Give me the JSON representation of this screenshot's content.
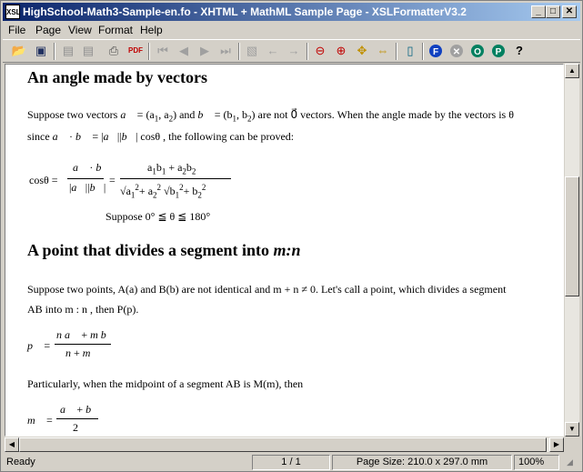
{
  "window": {
    "title": "HighSchool-Math3-Sample-en.fo - XHTML + MathML Sample Page - XSLFormatterV3.2",
    "icon_text": "XSL"
  },
  "menu": [
    "File",
    "Page",
    "View",
    "Format",
    "Help"
  ],
  "toolbar": {
    "icons": [
      "open-icon",
      "save-icon",
      "page-icon",
      "page-copy-icon",
      "print-icon",
      "pdf-icon",
      "first-page-icon",
      "prev-page-icon",
      "next-page-icon",
      "last-page-icon",
      "page-back-icon",
      "history-back-icon",
      "history-forward-icon",
      "zoom-out-icon",
      "zoom-in-icon",
      "fit-page-icon",
      "fit-width-icon",
      "single-page-icon",
      "f-icon",
      "x-icon",
      "o-icon",
      "p-icon",
      "help-icon"
    ]
  },
  "doc": {
    "h1": "An angle made by vectors",
    "p1a": "Suppose two vectors",
    "p1b": "= (a",
    "p1c": "and",
    "p1d": "= (b",
    "p1e": "are not",
    "p1f": "vectors. When the angle made by the vectors is θ",
    "p2a": "since",
    "p2b": "cosθ , the following can be proved:",
    "cos_label": "cosθ =",
    "suppose": "Suppose  0° ≦ θ ≦ 180°",
    "h2a": "A point that divides a segment into",
    "h2b": "m:n",
    "p3": "Suppose two points, A(a) and B(b) are not identical and m + n ≠ 0. Let's call a point, which divides a segment",
    "p4": "AB into m : n , then P(p).",
    "p5": "Particularly, when the midpoint of a segment AB is M(m), then"
  },
  "status": {
    "ready": "Ready",
    "page": "1 / 1",
    "page_size": "Page Size: 210.0 x 297.0 mm",
    "zoom": "100%"
  }
}
